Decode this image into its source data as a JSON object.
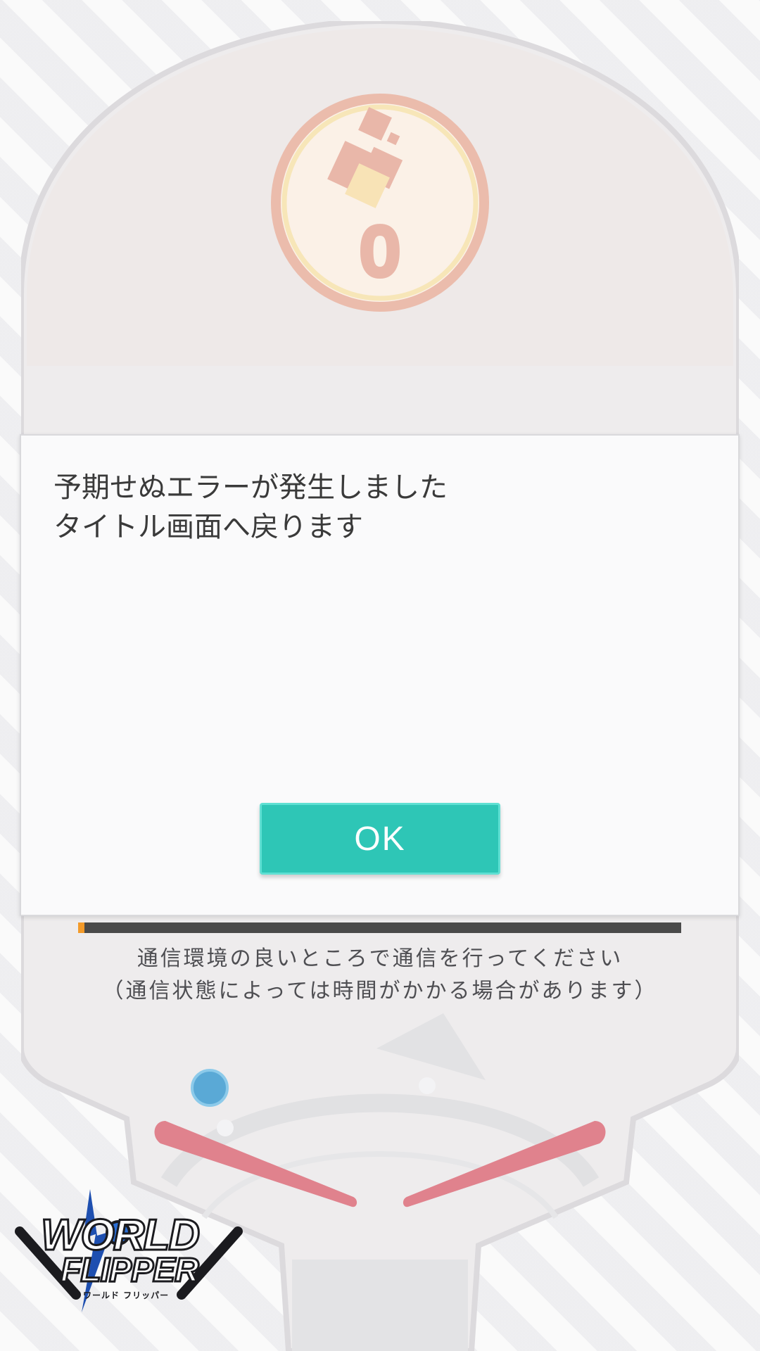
{
  "dialog": {
    "message_lines": [
      "予期せぬエラーが発生しました",
      "タイトル画面へ戻ります"
    ],
    "ok_label": "OK"
  },
  "counter": {
    "value": "0"
  },
  "loading": {
    "progress": 0.01,
    "notice_lines": [
      "通信環境の良いところで通信を行ってください",
      "（通信状態によっては時間がかかる場合があります）"
    ]
  },
  "logo": {
    "line1": "WORLD",
    "line2": "FLIPPER",
    "sub": "ワールド フリッパー"
  },
  "colors": {
    "ok_button": "#2ec6b6",
    "progress_fill": "#f39a2a",
    "flipper": "#e0828d",
    "ball": "#5aa9d6"
  }
}
